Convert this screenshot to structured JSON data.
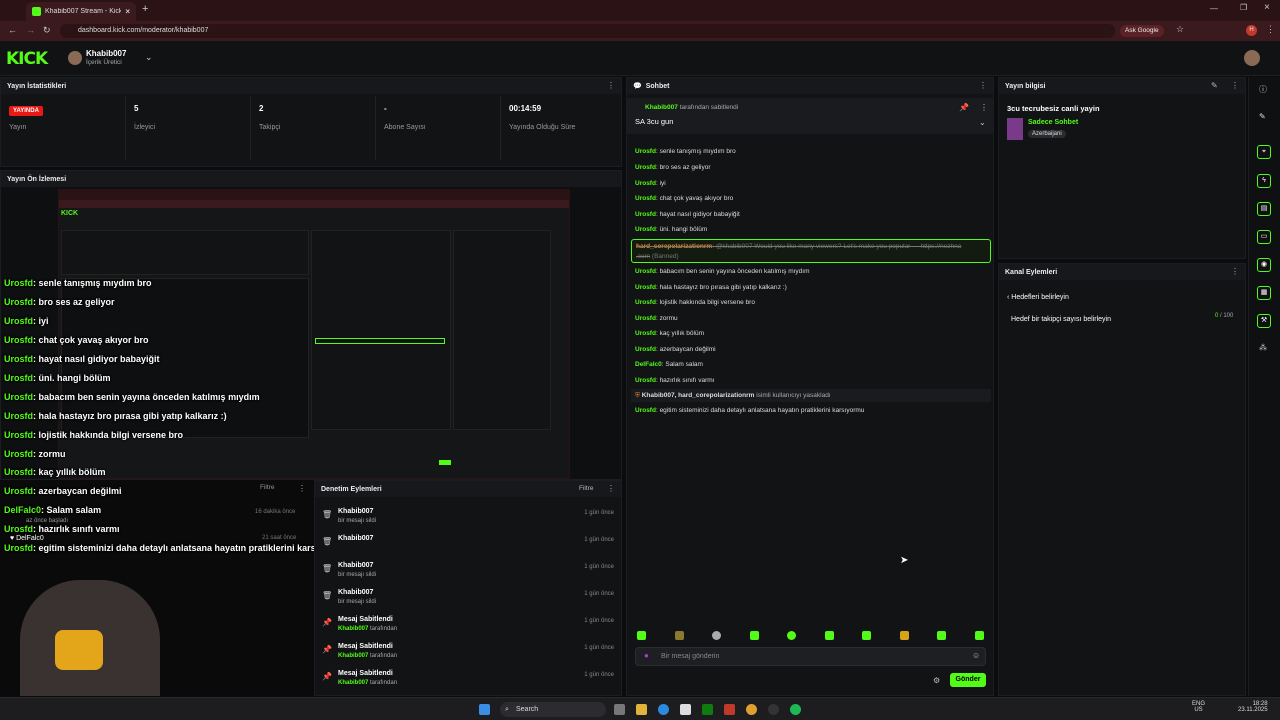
{
  "browser": {
    "tab_title": "Khabib007 Stream - Kick Dashb",
    "url": "dashboard.kick.com/moderator/khabib007",
    "ask_google": "Ask Google"
  },
  "header": {
    "logo": "KICK",
    "username": "Khabib007",
    "role": "İçerik Üretici"
  },
  "stats": {
    "title": "Yayın İstatistikleri",
    "live_badge": "YAYINDA",
    "items": [
      {
        "value": "",
        "label": "Yayın"
      },
      {
        "value": "5",
        "label": "İzleyici"
      },
      {
        "value": "2",
        "label": "Takipçi"
      },
      {
        "value": "-",
        "label": "Abone Sayısı"
      },
      {
        "value": "00:14:59",
        "label": "Yayında Olduğu Süre"
      }
    ]
  },
  "preview": {
    "title": "Yayın Ön İzlemesi"
  },
  "overlay_chat": [
    {
      "user": "Urosfd",
      "text": ": senle tanışmış mıydım bro"
    },
    {
      "user": "Urosfd",
      "text": ": bro ses az geliyor"
    },
    {
      "user": "Urosfd",
      "text": ": iyi"
    },
    {
      "user": "Urosfd",
      "text": ": chat çok yavaş akıyor bro"
    },
    {
      "user": "Urosfd",
      "text": ": hayat nasıl gidiyor babayiğit"
    },
    {
      "user": "Urosfd",
      "text": ": üni. hangi bölüm"
    },
    {
      "user": "Urosfd",
      "text": ": babacım ben senin yayına önceden katılmış mıydım"
    },
    {
      "user": "Urosfd",
      "text": ": hala hastayız bro pırasa gibi yatıp kalkarız :)"
    },
    {
      "user": "Urosfd",
      "text": ": lojistik hakkında bilgi versene bro"
    },
    {
      "user": "Urosfd",
      "text": ": zormu"
    },
    {
      "user": "Urosfd",
      "text": ": kaç yıllık bölüm"
    },
    {
      "user": "Urosfd",
      "text": ": azerbaycan değilmi"
    },
    {
      "user": "DelFalc0",
      "text": ": Salam salam"
    },
    {
      "user": "Urosfd",
      "text": ": hazırlık sınıfı varmı"
    },
    {
      "user": "Urosfd",
      "text": ": egitim sisteminizi daha detaylı anlatsana hayatın pratiklerini karsıyormu"
    }
  ],
  "activity": {
    "filter": "Filtre",
    "times": [
      "16 dakika önce",
      "21 saat önce"
    ],
    "user_label": "DelFalc0",
    "small_text": "az önce başladı"
  },
  "moderation": {
    "title": "Denetim Eylemleri",
    "filter": "Filtre",
    "items": [
      {
        "title": "Khabib007",
        "sub": "bir mesajı sildi",
        "time": "1 gün önce"
      },
      {
        "title": "Khabib007",
        "sub": "",
        "time": "1 gün önce"
      },
      {
        "title": "Khabib007",
        "sub": "bir mesajı sildi",
        "time": "1 gün önce"
      },
      {
        "title": "Khabib007",
        "sub": "bir mesajı sildi",
        "time": "1 gün önce"
      },
      {
        "title": "Mesaj Sabitlendi",
        "sub_user": "Khabib007",
        "sub": " tarafından",
        "time": "1 gün önce"
      },
      {
        "title": "Mesaj Sabitlendi",
        "sub_user": "Khabib007",
        "sub": " tarafından",
        "time": "1 gün önce"
      },
      {
        "title": "Mesaj Sabitlendi",
        "sub_user": "Khabib007",
        "sub": " tarafından",
        "time": "1 gün önce"
      }
    ]
  },
  "chat": {
    "title": "Sohbet",
    "pinned_by_user": "Khabib007",
    "pinned_by_text": "tarafından sabitlendi",
    "pinned_msg": "SA 3cu gun",
    "first_partial": "Khabib007: SA 3cu gun",
    "messages": [
      {
        "user": "Urosfd",
        "text": ": senle tanışmış mıydım bro"
      },
      {
        "user": "Urosfd",
        "text": ": bro ses az geliyor"
      },
      {
        "user": "Urosfd",
        "text": ": iyi"
      },
      {
        "user": "Urosfd",
        "text": ": chat çok yavaş akıyor bro"
      },
      {
        "user": "Urosfd",
        "text": ": hayat nasıl gidiyor babayiğit"
      },
      {
        "user": "Urosfd",
        "text": ": üni. hangi bölüm"
      }
    ],
    "banned_user": "hard_corepolarizationrm",
    "banned_text": ": @khabib007 Would you like many viewers? Let's make you popular — https://nezhna",
    "banned_text2": ".com",
    "banned_tag": "(Banned)",
    "messages2": [
      {
        "user": "Urosfd",
        "text": ": babacım ben senin yayına önceden katılmış mıydım"
      },
      {
        "user": "Urosfd",
        "text": ": hala hastayız bro pırasa gibi yatıp kalkarız :)"
      },
      {
        "user": "Urosfd",
        "text": ": lojistik hakkında bilgi versene bro"
      },
      {
        "user": "Urosfd",
        "text": ": zormu"
      },
      {
        "user": "Urosfd",
        "text": ": kaç yıllık bölüm"
      },
      {
        "user": "Urosfd",
        "text": ": azerbaycan değilmi"
      },
      {
        "user": "DelFalc0",
        "text": ": Salam salam"
      },
      {
        "user": "Urosfd",
        "text": ": hazırlık sınıfı varmı"
      }
    ],
    "mod_notice_users": "Khabib007, hard_corepolarizationrm",
    "mod_notice_text": " isimli kullanıcıyı yasakladı",
    "last_user": "Urosfd",
    "last_text": ": egitim sisteminizi daha detaylı anlatsana hayatın pratiklerini karsıyormu",
    "input_placeholder": "Bir mesaj gönderin",
    "send": "Gönder"
  },
  "stream_info": {
    "title": "Yayın bilgisi",
    "stream_title": "3cu tecrubesiz canli yayin",
    "category": "Sadece Sohbet",
    "tag": "Azerbaijani"
  },
  "channel_actions": {
    "title": "Kanal Eylemleri",
    "back": "Hedefleri belirleyin",
    "goal_label": "Hedef bir takipçi sayısı belirleyin",
    "goal_current": "0",
    "goal_total": "/ 100"
  },
  "taskbar": {
    "search": "Search",
    "lang": "ENG",
    "region": "US",
    "time": "18:28",
    "date": "23.11.2025"
  },
  "colors": {
    "accent": "#53fc18",
    "live": "#e91916"
  }
}
